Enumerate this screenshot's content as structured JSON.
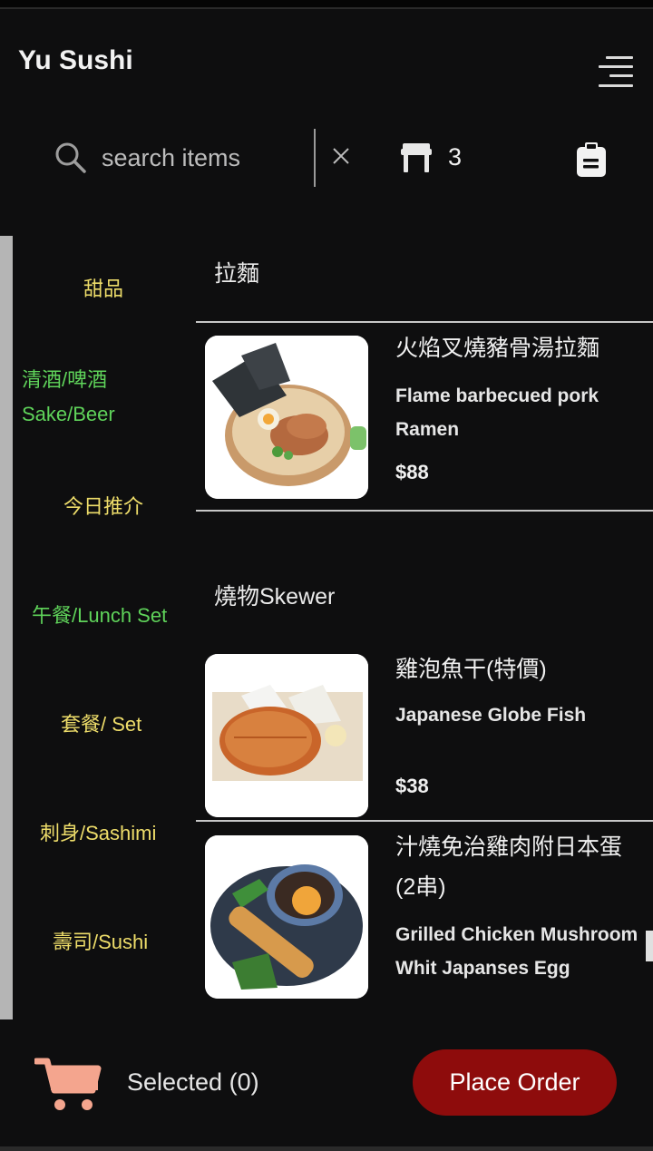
{
  "app": {
    "title": "Yu Sushi"
  },
  "search": {
    "placeholder": "search items",
    "clear_glyph": "×"
  },
  "table": {
    "count": "3"
  },
  "categories": [
    {
      "label": "甜品",
      "color": "#eedd6a"
    },
    {
      "label": "清酒/啤酒\nSake/Beer",
      "color": "#5fd35a"
    },
    {
      "label": "今日推介",
      "color": "#eedd6a"
    },
    {
      "label": "午餐/Lunch Set",
      "color": "#5fd35a"
    },
    {
      "label": "套餐/ Set",
      "color": "#eedd6a"
    },
    {
      "label": "刺身/Sashimi",
      "color": "#eedd6a"
    },
    {
      "label": "壽司/Sushi",
      "color": "#eedd6a"
    }
  ],
  "sections": [
    {
      "title": "拉麵",
      "items": [
        {
          "name_zh": "火焰叉燒豬骨湯拉麵",
          "name_en": "Flame barbecued pork Ramen",
          "price": "$88",
          "image": "ramen-bowl"
        }
      ]
    },
    {
      "title": "燒物Skewer",
      "items": [
        {
          "name_zh": "雞泡魚干(特價)",
          "name_en": "Japanese Globe Fish",
          "price": "$38",
          "image": "grilled-fish"
        },
        {
          "name_zh": "汁燒免治雞肉附日本蛋(2串)",
          "name_en": "Grilled Chicken Mushroom Whit Japanses Egg",
          "price": "",
          "image": "chicken-skewer"
        }
      ]
    }
  ],
  "cart": {
    "selected_label": "Selected (0)"
  },
  "order": {
    "button_label": "Place Order"
  },
  "colors": {
    "accent_red": "#8e0c0c",
    "cart_icon": "#f4a58e",
    "category_yellow": "#eedd6a",
    "category_green": "#5fd35a"
  },
  "icons": [
    "menu-icon",
    "search-icon",
    "close-icon",
    "table-icon",
    "clipboard-icon",
    "cart-icon"
  ]
}
